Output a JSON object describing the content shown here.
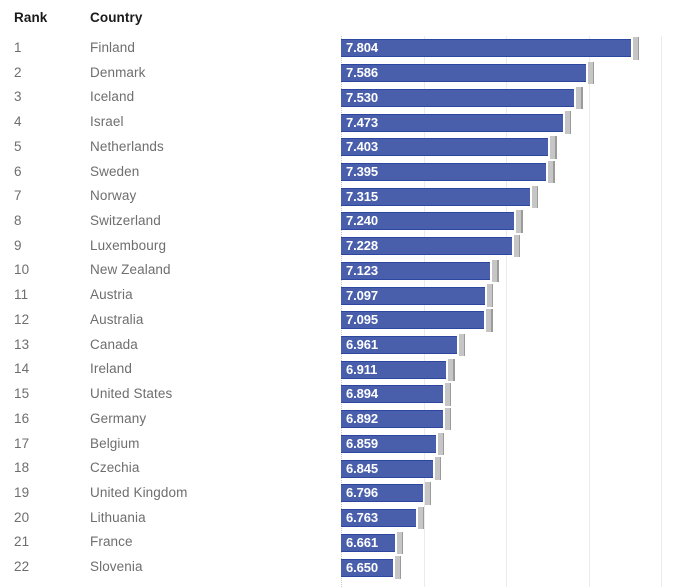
{
  "header": {
    "rank_label": "Rank",
    "country_label": "Country"
  },
  "style": {
    "bar_color": "#4a5fab",
    "bar_border_color": "#2d47a0",
    "bar_label_color": "#ffffff",
    "marker_color": "#c6c6c6",
    "gridline_color": "#eceaea",
    "row_text_color": "#6e6e6e",
    "header_text_color": "#1a1a1a",
    "background": "#ffffff"
  },
  "chart_data": {
    "type": "bar",
    "title": "",
    "subtitle": "",
    "xlabel": "",
    "ylabel": "",
    "orientation": "horizontal",
    "grid": true,
    "legend": "none",
    "xlim": [
      6.4,
      7.95
    ],
    "gridline_values": [
      6.4,
      6.8,
      7.2,
      7.6,
      7.95
    ],
    "categories": [
      "Finland",
      "Denmark",
      "Iceland",
      "Israel",
      "Netherlands",
      "Sweden",
      "Norway",
      "Switzerland",
      "Luxembourg",
      "New Zealand",
      "Austria",
      "Australia",
      "Canada",
      "Ireland",
      "United States",
      "Germany",
      "Belgium",
      "Czechia",
      "United Kingdom",
      "Lithuania",
      "France",
      "Slovenia"
    ],
    "values": [
      7.804,
      7.586,
      7.53,
      7.473,
      7.403,
      7.395,
      7.315,
      7.24,
      7.228,
      7.123,
      7.097,
      7.095,
      6.961,
      6.911,
      6.894,
      6.892,
      6.859,
      6.845,
      6.796,
      6.763,
      6.661,
      6.65
    ],
    "value_labels": [
      "7.804",
      "7.586",
      "7.530",
      "7.473",
      "7.403",
      "7.395",
      "7.315",
      "7.240",
      "7.228",
      "7.123",
      "7.097",
      "7.095",
      "6.961",
      "6.911",
      "6.894",
      "6.892",
      "6.859",
      "6.845",
      "6.796",
      "6.763",
      "6.661",
      "6.650"
    ],
    "ranks": [
      "1",
      "2",
      "3",
      "4",
      "5",
      "6",
      "7",
      "8",
      "9",
      "10",
      "11",
      "12",
      "13",
      "14",
      "15",
      "16",
      "17",
      "18",
      "19",
      "20",
      "21",
      "22"
    ]
  },
  "rows": [
    {
      "rank": "1",
      "country": "Finland",
      "value": "7.804"
    },
    {
      "rank": "2",
      "country": "Denmark",
      "value": "7.586"
    },
    {
      "rank": "3",
      "country": "Iceland",
      "value": "7.530"
    },
    {
      "rank": "4",
      "country": "Israel",
      "value": "7.473"
    },
    {
      "rank": "5",
      "country": "Netherlands",
      "value": "7.403"
    },
    {
      "rank": "6",
      "country": "Sweden",
      "value": "7.395"
    },
    {
      "rank": "7",
      "country": "Norway",
      "value": "7.315"
    },
    {
      "rank": "8",
      "country": "Switzerland",
      "value": "7.240"
    },
    {
      "rank": "9",
      "country": "Luxembourg",
      "value": "7.228"
    },
    {
      "rank": "10",
      "country": "New Zealand",
      "value": "7.123"
    },
    {
      "rank": "11",
      "country": "Austria",
      "value": "7.097"
    },
    {
      "rank": "12",
      "country": "Australia",
      "value": "7.095"
    },
    {
      "rank": "13",
      "country": "Canada",
      "value": "6.961"
    },
    {
      "rank": "14",
      "country": "Ireland",
      "value": "6.911"
    },
    {
      "rank": "15",
      "country": "United States",
      "value": "6.894"
    },
    {
      "rank": "16",
      "country": "Germany",
      "value": "6.892"
    },
    {
      "rank": "17",
      "country": "Belgium",
      "value": "6.859"
    },
    {
      "rank": "18",
      "country": "Czechia",
      "value": "6.845"
    },
    {
      "rank": "19",
      "country": "United Kingdom",
      "value": "6.796"
    },
    {
      "rank": "20",
      "country": "Lithuania",
      "value": "6.763"
    },
    {
      "rank": "21",
      "country": "France",
      "value": "6.661"
    },
    {
      "rank": "22",
      "country": "Slovenia",
      "value": "6.650"
    }
  ]
}
